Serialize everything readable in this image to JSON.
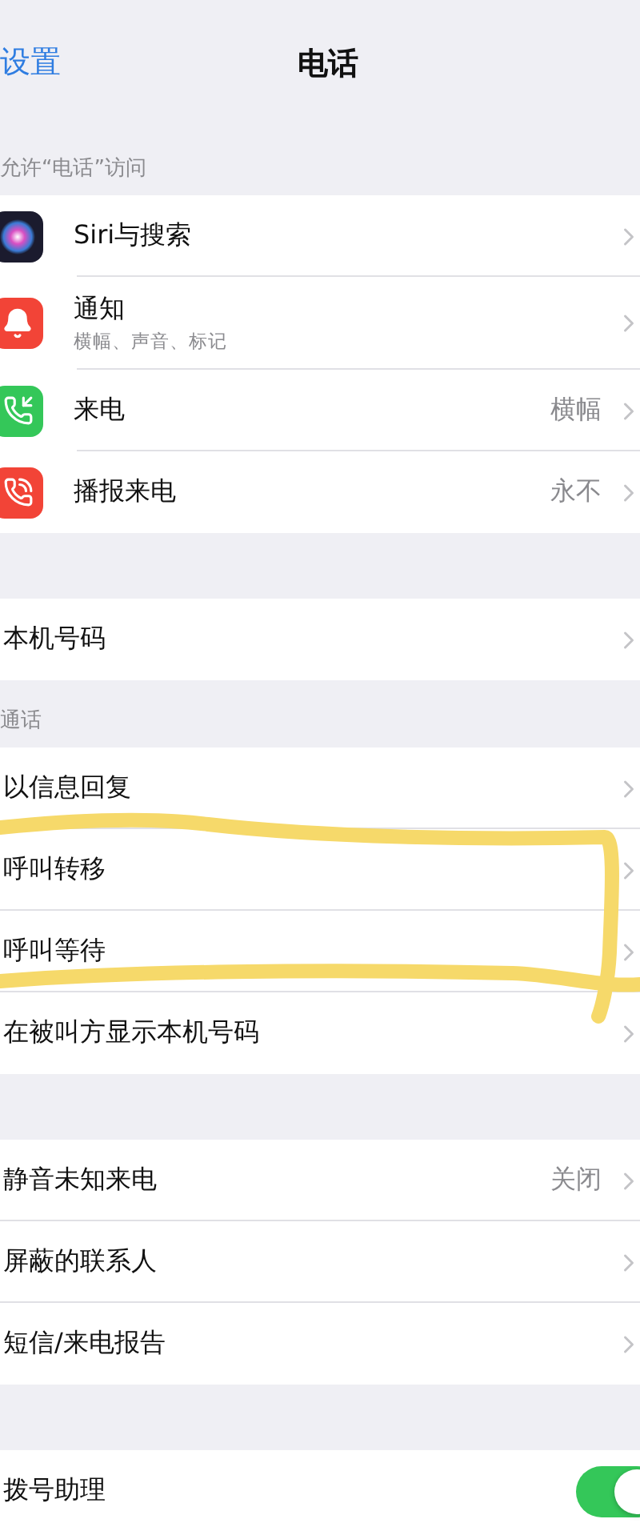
{
  "nav": {
    "back": "设置",
    "title": "电话"
  },
  "sections": [
    {
      "header": "允许“电话”访问",
      "with_icons": true,
      "rows": [
        {
          "kind": "link",
          "title": "Siri与搜索"
        },
        {
          "kind": "link",
          "title": "通知",
          "subtitle": "横幅、声音、标记"
        },
        {
          "kind": "link",
          "title": "来电",
          "value": "横幅"
        },
        {
          "kind": "link",
          "title": "播报来电",
          "value": "永不"
        }
      ]
    },
    {
      "with_icons": false,
      "rows": [
        {
          "kind": "link",
          "title": "本机号码"
        }
      ]
    },
    {
      "header": "通话",
      "with_icons": false,
      "rows": [
        {
          "kind": "link",
          "title": "以信息回复"
        },
        {
          "kind": "link",
          "title": "呼叫转移"
        },
        {
          "kind": "link",
          "title": "呼叫等待"
        },
        {
          "kind": "link",
          "title": "在被叫方显示本机号码"
        }
      ]
    },
    {
      "with_icons": false,
      "rows": [
        {
          "kind": "link",
          "title": "静音未知来电",
          "value": "关闭"
        },
        {
          "kind": "link",
          "title": "屏蔽的联系人"
        },
        {
          "kind": "link",
          "title": "短信/来电报告"
        }
      ]
    },
    {
      "with_icons": false,
      "rows": [
        {
          "kind": "toggle",
          "title": "拨号助理",
          "on": true
        }
      ]
    }
  ]
}
